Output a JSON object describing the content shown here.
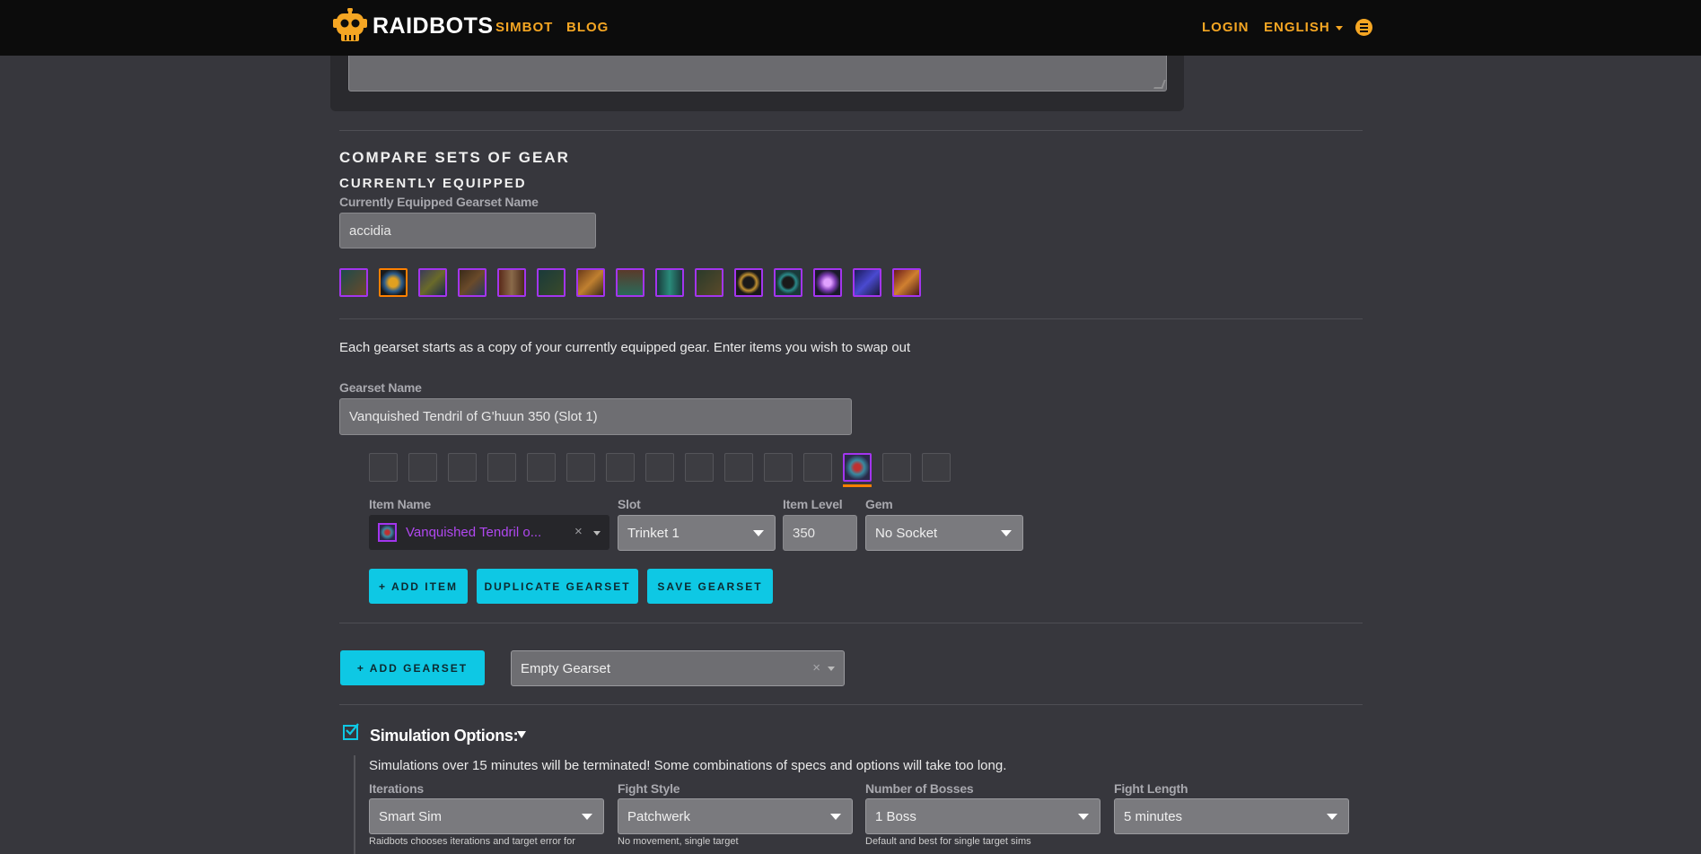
{
  "nav": {
    "brand": "RAIDBOTS",
    "simbot": "SIMBOT",
    "blog": "BLOG",
    "login": "LOGIN",
    "language": "ENGLISH"
  },
  "compare": {
    "title": "COMPARE SETS OF GEAR",
    "equipped_heading": "CURRENTLY EQUIPPED",
    "equipped_name_label": "Currently Equipped Gearset Name",
    "equipped_name_value": "accidia",
    "intro": "Each gearset starts as a copy of your currently equipped gear. Enter items you wish to swap out",
    "gearset_name_label": "Gearset Name",
    "gearset_name_value": "Vanquished Tendril of G'huun 350 (Slot 1)"
  },
  "item_form": {
    "item_name_label": "Item Name",
    "item_name_value": "Vanquished Tendril o...",
    "item_clear": "×",
    "slot_label": "Slot",
    "slot_value": "Trinket 1",
    "ilvl_label": "Item Level",
    "ilvl_value": "350",
    "gem_label": "Gem",
    "gem_value": "No Socket",
    "add_item": "+ ADD ITEM",
    "duplicate_gearset": "DUPLICATE GEARSET",
    "save_gearset": "SAVE GEARSET"
  },
  "gearset_controls": {
    "add_gearset": "+ ADD GEARSET",
    "selector_value": "Empty Gearset",
    "selector_clear": "×"
  },
  "sim_options": {
    "title": "Simulation Options:",
    "warning": "Simulations over 15 minutes will be terminated! Some combinations of specs and options will take too long.",
    "iterations_label": "Iterations",
    "iterations_value": "Smart Sim",
    "iterations_help": "Raidbots chooses iterations and target error for",
    "fight_style_label": "Fight Style",
    "fight_style_value": "Patchwerk",
    "fight_style_help": "No movement, single target",
    "bosses_label": "Number of Bosses",
    "bosses_value": "1 Boss",
    "bosses_help": "Default and best for single target sims",
    "length_label": "Fight Length",
    "length_value": "5 minutes"
  },
  "colors": {
    "accent": "#0ec8e4",
    "nav_link": "#f5a623",
    "epic": "#a335ee",
    "legendary": "#ff8000"
  },
  "icons": {
    "logo": "robot-skull-icon",
    "menu": "list-menu-icon"
  }
}
